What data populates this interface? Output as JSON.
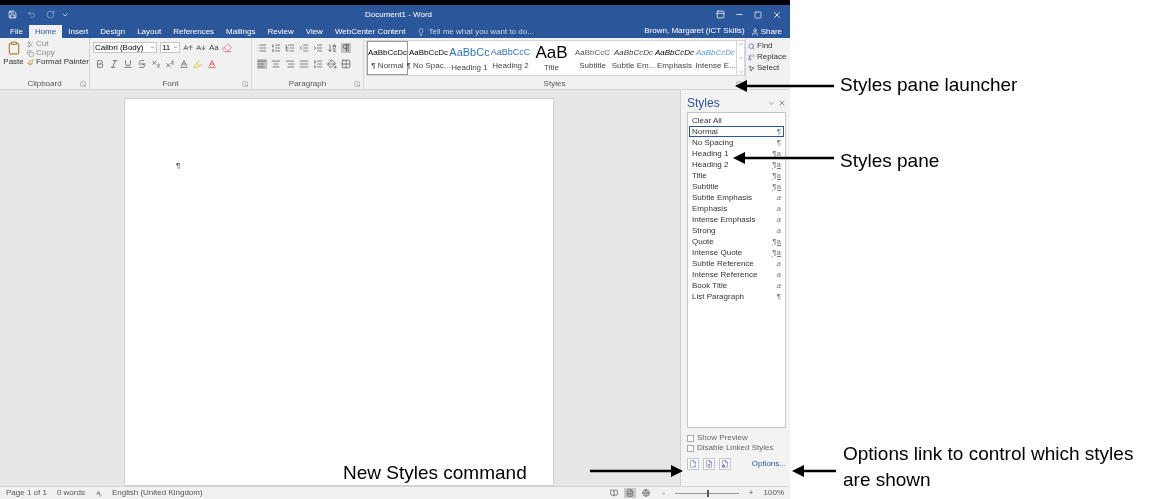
{
  "title_bar": {
    "title": "Document1 - Word"
  },
  "tabs": [
    {
      "label": "File",
      "selected": false
    },
    {
      "label": "Home",
      "selected": true
    },
    {
      "label": "Insert",
      "selected": false
    },
    {
      "label": "Design",
      "selected": false
    },
    {
      "label": "Layout",
      "selected": false
    },
    {
      "label": "References",
      "selected": false
    },
    {
      "label": "Mailings",
      "selected": false
    },
    {
      "label": "Review",
      "selected": false
    },
    {
      "label": "View",
      "selected": false
    },
    {
      "label": "WebCenter Content",
      "selected": false
    }
  ],
  "tell_me": {
    "placeholder": "Tell me what you want to do..."
  },
  "user": "Brown, Margaret (ICT Skills)",
  "share": "Share",
  "ribbon": {
    "clipboard": {
      "paste": "Paste",
      "cut": "Cut",
      "copy": "Copy",
      "format_painter": "Format Painter",
      "label": "Clipboard"
    },
    "font": {
      "name": "Calibri (Body)",
      "size": "11",
      "case": "Aa",
      "label": "Font"
    },
    "paragraph": {
      "label": "Paragraph",
      "show_marks_on": true
    },
    "styles": {
      "label": "Styles",
      "items": [
        {
          "preview": "AaBbCcDc",
          "name": "¶ Normal",
          "kind": "normal",
          "selected": true
        },
        {
          "preview": "AaBbCcDc",
          "name": "¶ No Spac...",
          "kind": "normal",
          "selected": false
        },
        {
          "preview": "AaBbCc",
          "name": "Heading 1",
          "kind": "heading1",
          "selected": false
        },
        {
          "preview": "AaBbCcC",
          "name": "Heading 2",
          "kind": "heading2",
          "selected": false
        },
        {
          "preview": "AaB",
          "name": "Title",
          "kind": "title",
          "selected": false
        },
        {
          "preview": "AaBbCcC",
          "name": "Subtitle",
          "kind": "subtitle",
          "selected": false
        },
        {
          "preview": "AaBbCcDc",
          "name": "Subtle Em...",
          "kind": "subtle",
          "selected": false
        },
        {
          "preview": "AaBbCcDc",
          "name": "Emphasis",
          "kind": "emphasis",
          "selected": false
        },
        {
          "preview": "AaBbCcDc",
          "name": "Intense E...",
          "kind": "intense",
          "selected": false
        }
      ]
    },
    "editing": {
      "find": "Find",
      "replace": "Replace",
      "select": "Select"
    }
  },
  "document": {
    "mark": "¶"
  },
  "styles_pane": {
    "title": "Styles",
    "items": [
      {
        "name": "Clear All",
        "kind": "none",
        "selected": false
      },
      {
        "name": "Normal",
        "symbol": "¶",
        "kind": "paragraph",
        "selected": true
      },
      {
        "name": "No Spacing",
        "symbol": "¶",
        "kind": "paragraph",
        "selected": false
      },
      {
        "name": "Heading 1",
        "symbol": "¶a",
        "kind": "linked",
        "selected": false
      },
      {
        "name": "Heading 2",
        "symbol": "¶a",
        "kind": "linked",
        "selected": false
      },
      {
        "name": "Title",
        "symbol": "¶a",
        "kind": "linked",
        "selected": false
      },
      {
        "name": "Subtitle",
        "symbol": "¶a",
        "kind": "linked",
        "selected": false
      },
      {
        "name": "Subtle Emphasis",
        "symbol": "a",
        "kind": "character",
        "selected": false
      },
      {
        "name": "Emphasis",
        "symbol": "a",
        "kind": "character",
        "selected": false
      },
      {
        "name": "Intense Emphasis",
        "symbol": "a",
        "kind": "character",
        "selected": false
      },
      {
        "name": "Strong",
        "symbol": "a",
        "kind": "character",
        "selected": false
      },
      {
        "name": "Quote",
        "symbol": "¶a",
        "kind": "linked",
        "selected": false
      },
      {
        "name": "Intense Quote",
        "symbol": "¶a",
        "kind": "linked",
        "selected": false
      },
      {
        "name": "Subtle Reference",
        "symbol": "a",
        "kind": "character",
        "selected": false
      },
      {
        "name": "Intense Reference",
        "symbol": "a",
        "kind": "character",
        "selected": false
      },
      {
        "name": "Book Title",
        "symbol": "a",
        "kind": "character",
        "selected": false
      },
      {
        "name": "List Paragraph",
        "symbol": "¶",
        "kind": "paragraph",
        "selected": false
      }
    ],
    "options": [
      {
        "label": "Show Preview",
        "checked": false
      },
      {
        "label": "Disable Linked Styles",
        "checked": false
      }
    ],
    "options_link": "Options..."
  },
  "status_bar": {
    "page": "Page 1 of 1",
    "words": "0 words",
    "language": "English (United Kingdom)",
    "views": [
      {
        "selected": false
      },
      {
        "selected": true
      },
      {
        "selected": false
      }
    ],
    "zoom_minus": "-",
    "zoom_plus": "+",
    "zoom": {
      "level": 0.5
    },
    "zoom_percent": "100%"
  },
  "annotations": [
    "Styles pane launcher",
    "Styles pane",
    "New Styles command",
    "Options link to control which styles are shown"
  ]
}
